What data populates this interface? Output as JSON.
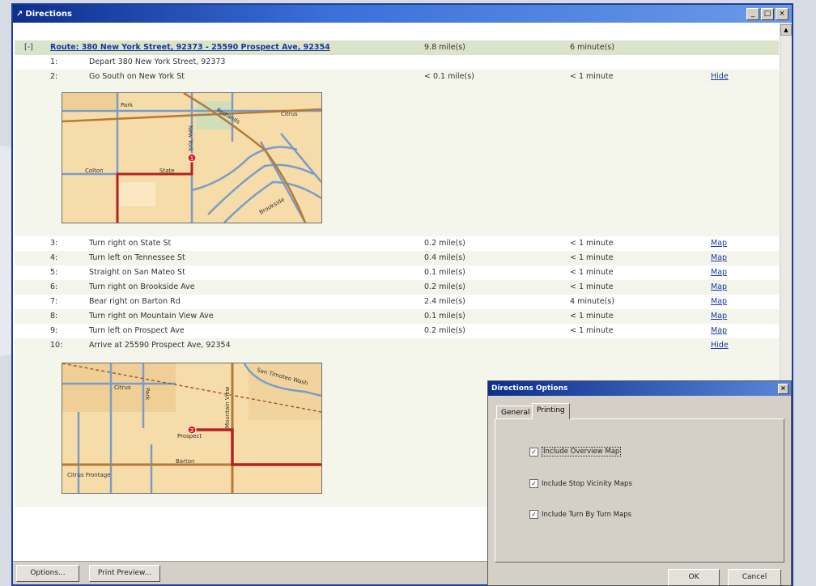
{
  "window": {
    "title": "Directions",
    "controls": [
      "_",
      "□",
      "×"
    ]
  },
  "route": {
    "toggle": "[-]",
    "title": "Route: 380 New York Street, 92373 - 25590 Prospect Ave, 92354",
    "distance": "9.8 mile(s)",
    "time": "6 minute(s)"
  },
  "steps": [
    {
      "num": "1:",
      "text": "Depart 380 New York Street, 92373",
      "dist": "",
      "time": "",
      "link": ""
    },
    {
      "num": "2:",
      "text": "Go South on New York St",
      "dist": "< 0.1 mile(s)",
      "time": "< 1 minute",
      "link": "Hide"
    },
    {
      "num": "3:",
      "text": "Turn right on State St",
      "dist": "0.2 mile(s)",
      "time": "< 1 minute",
      "link": "Map"
    },
    {
      "num": "4:",
      "text": "Turn left on Tennessee St",
      "dist": "0.4 mile(s)",
      "time": "< 1 minute",
      "link": "Map"
    },
    {
      "num": "5:",
      "text": "Straight on San Mateo St",
      "dist": "0.1 mile(s)",
      "time": "< 1 minute",
      "link": "Map"
    },
    {
      "num": "6:",
      "text": "Turn right on Brookside Ave",
      "dist": "0.2 mile(s)",
      "time": "< 1 minute",
      "link": "Map"
    },
    {
      "num": "7:",
      "text": "Bear right on Barton Rd",
      "dist": "2.4 mile(s)",
      "time": "4 minute(s)",
      "link": "Map"
    },
    {
      "num": "8:",
      "text": "Turn right on Mountain View Ave",
      "dist": "0.1 mile(s)",
      "time": "< 1 minute",
      "link": "Map"
    },
    {
      "num": "9:",
      "text": "Turn left on Prospect Ave",
      "dist": "0.2 mile(s)",
      "time": "< 1 minute",
      "link": "Map"
    },
    {
      "num": "10:",
      "text": "Arrive at 25590 Prospect Ave, 92354",
      "dist": "",
      "time": "",
      "link": "Hide"
    }
  ],
  "map1": {
    "labels": [
      "Park",
      "Redlands",
      "Citrus",
      "Colton",
      "State",
      "New York",
      "Brookside"
    ],
    "marker": "1"
  },
  "map2": {
    "labels": [
      "Citrus",
      "Park",
      "Prospect",
      "Barton",
      "Mountain View",
      "Citrus Frontage",
      "San Timoteo Wash"
    ],
    "marker": "2"
  },
  "bottom": {
    "options_label": "Options...",
    "print_label": "Print Preview..."
  },
  "dialog": {
    "title": "Directions Options",
    "tabs": [
      "General",
      "Printing"
    ],
    "options": [
      {
        "label": "Include Overview Map",
        "checked": true
      },
      {
        "label": "Include Stop Vicinity Maps",
        "checked": true
      },
      {
        "label": "Include Turn By Turn Maps",
        "checked": true
      }
    ],
    "ok_label": "OK",
    "cancel_label": "Cancel"
  },
  "colors": {
    "titlebar": "#0d2e8c",
    "route_bg": "#dbe3c9",
    "link": "#1a36a0",
    "route_line": "#b22222",
    "map_bg": "#f6dca8"
  }
}
